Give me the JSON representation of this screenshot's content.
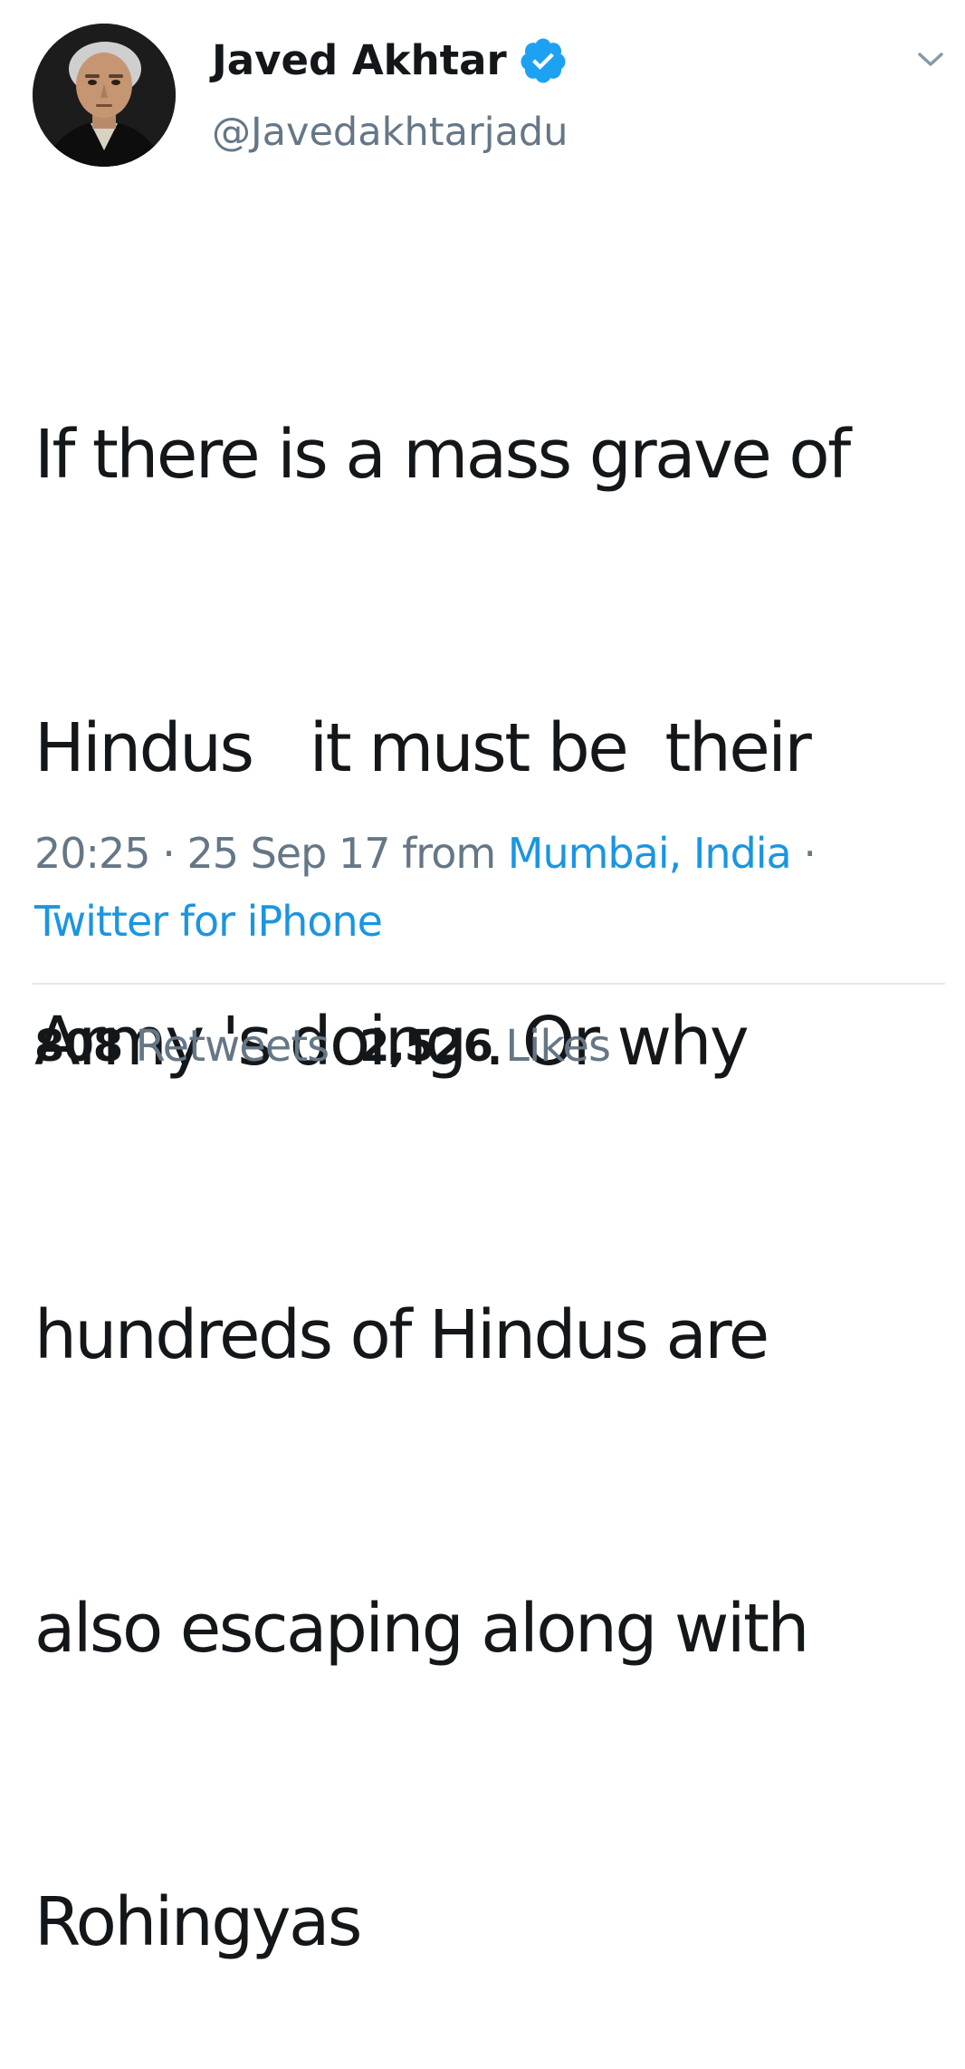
{
  "tweet": {
    "author": {
      "display_name": "Javed Akhtar",
      "handle": "@Javedakhtarjadu",
      "verified_icon": "verified-badge-icon",
      "avatar_icon": "profile-avatar"
    },
    "menu_icon": "chevron-down-icon",
    "text_lines": [
      "If there is a mass grave of",
      "Hindus   it must be  their",
      "Army 's doing . Or why",
      "hundreds of Hindus are",
      "also escaping along with",
      "Rohingyas"
    ],
    "time": "20:25",
    "separator": "·",
    "date": "25 Sep 17",
    "from_label": "from",
    "location": "Mumbai, India",
    "source": "Twitter for iPhone",
    "retweets_count": "808",
    "retweets_label": "Retweets",
    "likes_count": "2,526",
    "likes_label": "Likes"
  },
  "colors": {
    "text": "#14171a",
    "secondary": "#657786",
    "link": "#1b95e0",
    "verified": "#1da1f2",
    "divider": "#e1e8ed"
  }
}
